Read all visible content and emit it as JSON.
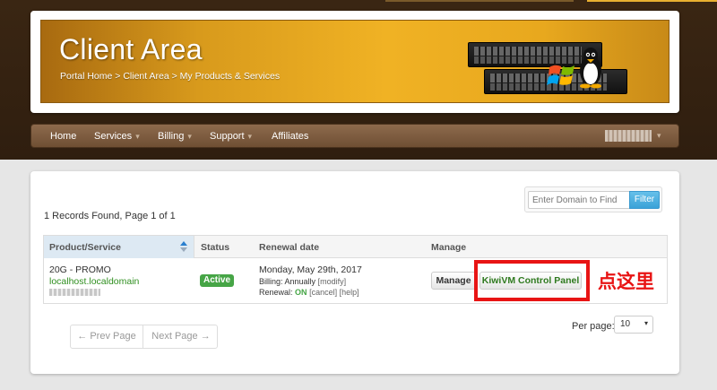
{
  "header": {
    "title": "Client Area",
    "breadcrumb": "Portal Home > Client Area > My Products & Services"
  },
  "nav": {
    "items": [
      {
        "label": "Home",
        "dropdown": false
      },
      {
        "label": "Services",
        "dropdown": true
      },
      {
        "label": "Billing",
        "dropdown": true
      },
      {
        "label": "Support",
        "dropdown": true
      },
      {
        "label": "Affiliates",
        "dropdown": false
      }
    ],
    "caret": "▾"
  },
  "search": {
    "placeholder": "Enter Domain to Find",
    "button_label": "Filter"
  },
  "records_text": "1 Records Found, Page 1 of 1",
  "table": {
    "headers": [
      "Product/Service",
      "Status",
      "Renewal date",
      "Manage"
    ],
    "row": {
      "product": "20G - PROMO",
      "domain": "localhost.localdomain",
      "status": "Active",
      "renewal_date": "Monday, May 29th, 2017",
      "billing_label": "Billing: Annually",
      "billing_link": "modify",
      "renewal_label": "Renewal:",
      "renewal_state": "ON",
      "renewal_cancel": "cancel",
      "renewal_help": "help",
      "manage_button": "Manage",
      "panel_button": "KiwiVM Control Panel"
    }
  },
  "annotation": "点这里",
  "pagination": {
    "prev": "← Prev Page",
    "next": "Next Page →"
  },
  "per_page": {
    "label": "Per page:",
    "value": "10"
  },
  "colors": {
    "accent_blue": "#3aa2d8",
    "status_green": "#46a546",
    "highlight_red": "#e81414",
    "banner_orange": "#f0b224"
  }
}
